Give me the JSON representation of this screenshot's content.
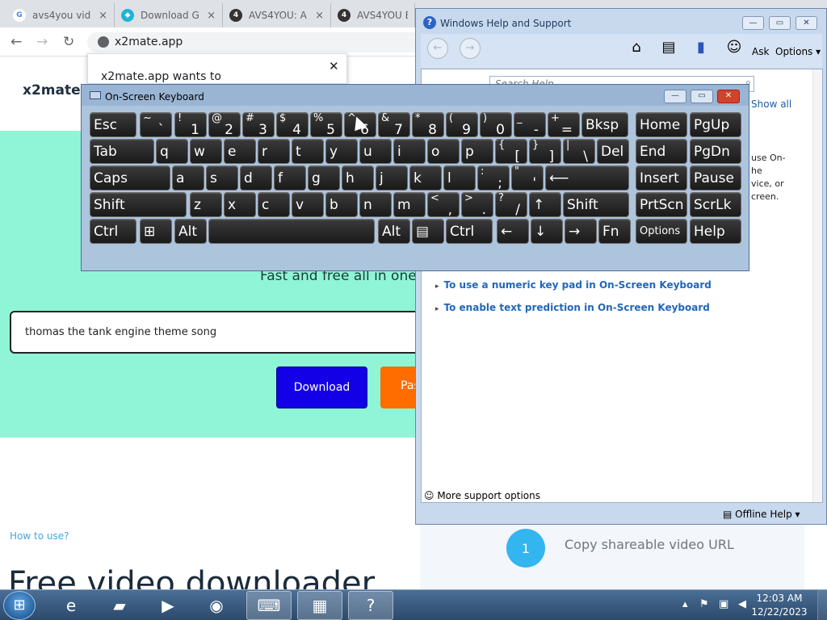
{
  "browser": {
    "tabs": [
      {
        "title": "avs4you vid",
        "favicon": "google-icon",
        "fav_color": "#4285f4",
        "fav_char": "G"
      },
      {
        "title": "Download G",
        "favicon": "gem-icon",
        "fav_color": "#1fb3d8",
        "fav_char": "◆"
      },
      {
        "title": "AVS4YOU: A",
        "favicon": "avs-icon",
        "fav_color": "#333333",
        "fav_char": "4"
      },
      {
        "title": "AVS4YOU Be",
        "favicon": "avs-icon",
        "fav_color": "#333333",
        "fav_char": "4"
      }
    ],
    "address": "x2mate.app"
  },
  "page": {
    "brand": "x2mate",
    "notification_title": "x2mate.app wants to",
    "tagline": "Fast and free all in one",
    "search_value": "thomas the tank engine theme song",
    "download_label": "Download",
    "paste_label": "Pas",
    "how_to": "How to use?",
    "big_heading": "Free video downloader",
    "step_number": "1",
    "step_text": "Copy shareable video URL",
    "colors": {
      "hero_bg": "#8ff5d6",
      "download_bg": "#1400e6",
      "paste_bg": "#ff6d00"
    }
  },
  "help": {
    "title": "Windows Help and Support",
    "ask": "Ask",
    "options": "Options",
    "search_placeholder": "Search Help",
    "show_all": "Show all",
    "fragments": [
      "use On-",
      "he",
      "vice, or",
      "creen."
    ],
    "links": [
      "To use a numeric key pad in On-Screen Keyboard",
      "To enable text prediction in On-Screen Keyboard"
    ],
    "more_support": "More support options",
    "offline_help": "Offline Help"
  },
  "osk": {
    "title": "On-Screen Keyboard",
    "keys": [
      {
        "l": "Esc"
      },
      {
        "s": "~",
        "m": "`"
      },
      {
        "s": "!",
        "m": "1"
      },
      {
        "s": "@",
        "m": "2"
      },
      {
        "s": "#",
        "m": "3"
      },
      {
        "s": "$",
        "m": "4"
      },
      {
        "s": "%",
        "m": "5"
      },
      {
        "s": "^",
        "m": "6"
      },
      {
        "s": "&",
        "m": "7"
      },
      {
        "s": "*",
        "m": "8"
      },
      {
        "s": "(",
        "m": "9"
      },
      {
        "s": ")",
        "m": "0"
      },
      {
        "s": "_",
        "m": "-"
      },
      {
        "s": "+",
        "m": "="
      },
      {
        "l": "Bksp"
      },
      {
        "l": "Home"
      },
      {
        "l": "PgUp"
      },
      {
        "l": "Tab"
      },
      {
        "l": "q"
      },
      {
        "l": "w"
      },
      {
        "l": "e"
      },
      {
        "l": "r"
      },
      {
        "l": "t"
      },
      {
        "l": "y"
      },
      {
        "l": "u"
      },
      {
        "l": "i"
      },
      {
        "l": "o"
      },
      {
        "l": "p"
      },
      {
        "s": "{",
        "m": "["
      },
      {
        "s": "}",
        "m": "]"
      },
      {
        "s": "|",
        "m": "\\"
      },
      {
        "l": "Del"
      },
      {
        "l": "End"
      },
      {
        "l": "PgDn"
      },
      {
        "l": "Caps"
      },
      {
        "l": "a"
      },
      {
        "l": "s"
      },
      {
        "l": "d"
      },
      {
        "l": "f"
      },
      {
        "l": "g"
      },
      {
        "l": "h"
      },
      {
        "l": "j"
      },
      {
        "l": "k"
      },
      {
        "l": "l"
      },
      {
        "s": ":",
        "m": ";"
      },
      {
        "s": "\"",
        "m": "'"
      },
      {
        "l": "⟵"
      },
      {
        "l": "Insert"
      },
      {
        "l": "Pause"
      },
      {
        "l": "Shift"
      },
      {
        "l": "z"
      },
      {
        "l": "x"
      },
      {
        "l": "c"
      },
      {
        "l": "v"
      },
      {
        "l": "b"
      },
      {
        "l": "n"
      },
      {
        "l": "m"
      },
      {
        "s": "<",
        "m": ","
      },
      {
        "s": ">",
        "m": "."
      },
      {
        "s": "?",
        "m": "/"
      },
      {
        "l": "↑"
      },
      {
        "l": "Shift"
      },
      {
        "l": "PrtScn"
      },
      {
        "l": "ScrLk"
      },
      {
        "l": "Ctrl"
      },
      {
        "l": "⊞"
      },
      {
        "l": "Alt"
      },
      {
        "l": ""
      },
      {
        "l": "Alt"
      },
      {
        "l": "▤"
      },
      {
        "l": "Ctrl"
      },
      {
        "l": "←"
      },
      {
        "l": "↓"
      },
      {
        "l": "→"
      },
      {
        "l": "Fn"
      },
      {
        "l": "Options",
        "small": true
      },
      {
        "l": "Help"
      }
    ]
  },
  "taskbar": {
    "time": "12:03 AM",
    "date": "12/22/2023",
    "apps": [
      "internet-explorer-icon",
      "file-explorer-icon",
      "media-player-icon",
      "chrome-icon",
      "on-screen-keyboard-icon",
      "movie-maker-icon",
      "help-icon"
    ]
  }
}
